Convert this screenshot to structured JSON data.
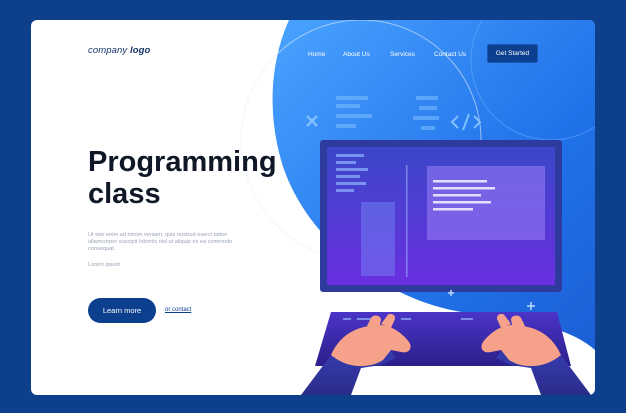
{
  "logo": {
    "regular": "company ",
    "bold": "logo"
  },
  "nav": {
    "items": [
      "Home",
      "About Us",
      "Services",
      "Contact Us"
    ],
    "cta": "Get Started"
  },
  "hero": {
    "title_line1": "Programming",
    "title_line2": "class",
    "description": "Ut wisi enim ad minim veniam, quis nostrud exerci tation ullamcorper suscipit lobortis nisl ut aliquip ex ea commodo consequat.",
    "subtext": "Lorem ipsum",
    "primary_button": "Learn more",
    "secondary_link": "or contact"
  },
  "colors": {
    "page_bg": "#0d3f8a",
    "accent_blue": "#2a7df0",
    "button_navy": "#0c3f8e",
    "screen_purple": "#5b2fd6"
  }
}
